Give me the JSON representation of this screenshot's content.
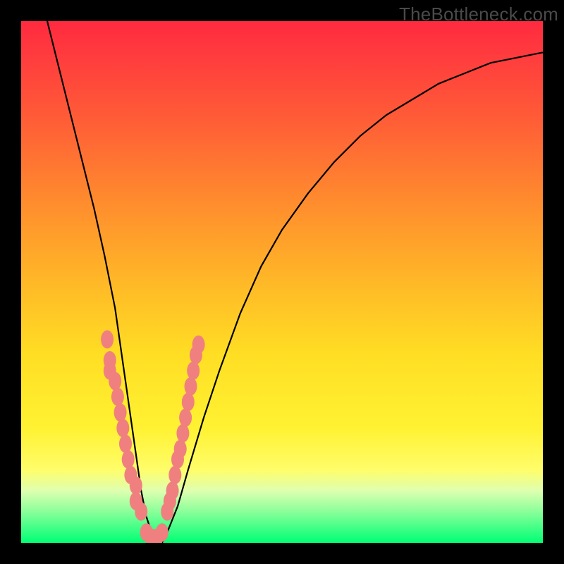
{
  "watermark": "TheBottleneck.com",
  "chart_data": {
    "type": "line",
    "title": "",
    "xlabel": "",
    "ylabel": "",
    "xlim": [
      0,
      100
    ],
    "ylim": [
      0,
      100
    ],
    "series": [
      {
        "name": "curve",
        "x": [
          5,
          8,
          10,
          12,
          14,
          16,
          18,
          19,
          20,
          21,
          22,
          23,
          24,
          25,
          26,
          27,
          28,
          30,
          32,
          35,
          38,
          42,
          46,
          50,
          55,
          60,
          65,
          70,
          75,
          80,
          85,
          90,
          95,
          100
        ],
        "y": [
          100,
          88,
          80,
          72,
          64,
          55,
          45,
          38,
          31,
          24,
          17,
          10,
          5,
          2,
          0,
          0,
          2,
          7,
          14,
          24,
          33,
          44,
          53,
          60,
          67,
          73,
          78,
          82,
          85,
          88,
          90,
          92,
          93,
          94
        ]
      }
    ],
    "markers": {
      "left_cluster": {
        "x": [
          16.5,
          17.0,
          17.0,
          18.0,
          18.5,
          19.0,
          19.5,
          20.0,
          20.5,
          21.0,
          22.0,
          22.0,
          23.0
        ],
        "y": [
          39,
          35,
          33,
          31,
          28,
          25,
          22,
          19,
          16,
          13,
          11,
          8,
          6
        ]
      },
      "bottom_cluster": {
        "x": [
          24.0,
          25.0,
          26.0,
          27.0
        ],
        "y": [
          2,
          1,
          1,
          2
        ]
      },
      "right_cluster": {
        "x": [
          28.0,
          28.5,
          29.0,
          29.5,
          30.0,
          30.5,
          31.0,
          31.5,
          32.0,
          32.5,
          33.0,
          33.5,
          34.0
        ],
        "y": [
          6,
          8,
          10,
          13,
          16,
          18,
          21,
          24,
          27,
          30,
          33,
          36,
          38
        ]
      }
    },
    "colors": {
      "marker_fill": "#f08080",
      "curve_stroke": "#000000"
    }
  }
}
